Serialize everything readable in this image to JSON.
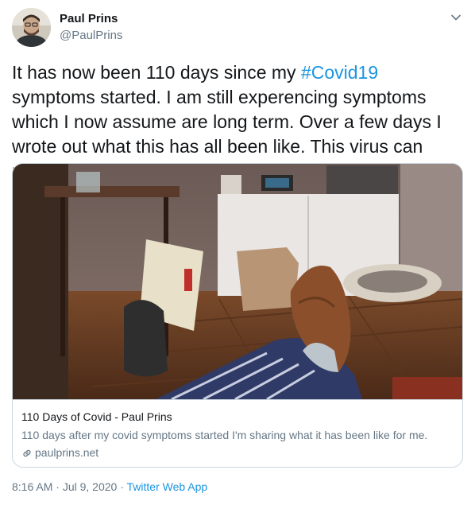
{
  "author": {
    "name": "Paul Prins",
    "handle": "@PaulPrins"
  },
  "tweet": {
    "text_before": "It has now been 110 days since my ",
    "hashtag": "#Covid19",
    "text_after": " symptoms started. I am still experencing symptoms which I now assume are long term. Over a few days I wrote out what this has all been like. This virus can really mess you up."
  },
  "card": {
    "title": "110 Days of Covid - Paul Prins",
    "description": "110 days after my covid symptoms started I'm sharing what it has been like for me.",
    "domain": "paulprins.net"
  },
  "meta": {
    "time": "8:16 AM",
    "separator1": " · ",
    "date": "Jul 9, 2020",
    "separator2": " · ",
    "source": "Twitter Web App"
  },
  "colors": {
    "link": "#1b95e0",
    "secondary_text": "#657786",
    "border": "#ccd6dd"
  },
  "icons": [
    "caret-down-icon",
    "link-icon"
  ]
}
